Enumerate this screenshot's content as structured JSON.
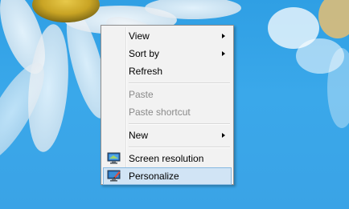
{
  "context_menu": {
    "items": [
      {
        "label": "View",
        "has_submenu": true,
        "enabled": true
      },
      {
        "label": "Sort by",
        "has_submenu": true,
        "enabled": true
      },
      {
        "label": "Refresh",
        "enabled": true
      },
      {
        "label": "Paste",
        "enabled": false
      },
      {
        "label": "Paste shortcut",
        "enabled": false
      },
      {
        "label": "New",
        "has_submenu": true,
        "enabled": true
      },
      {
        "label": "Screen resolution",
        "icon": "monitor-icon",
        "enabled": true
      },
      {
        "label": "Personalize",
        "icon": "personalize-icon",
        "enabled": true,
        "highlighted": true
      }
    ]
  },
  "colors": {
    "desktop_blue": "#2f9fe4",
    "menu_background": "#f2f2f2",
    "highlight_fill": "#d1e4f5",
    "highlight_border": "#86b8e0",
    "disabled_text": "#8a8a8a"
  }
}
